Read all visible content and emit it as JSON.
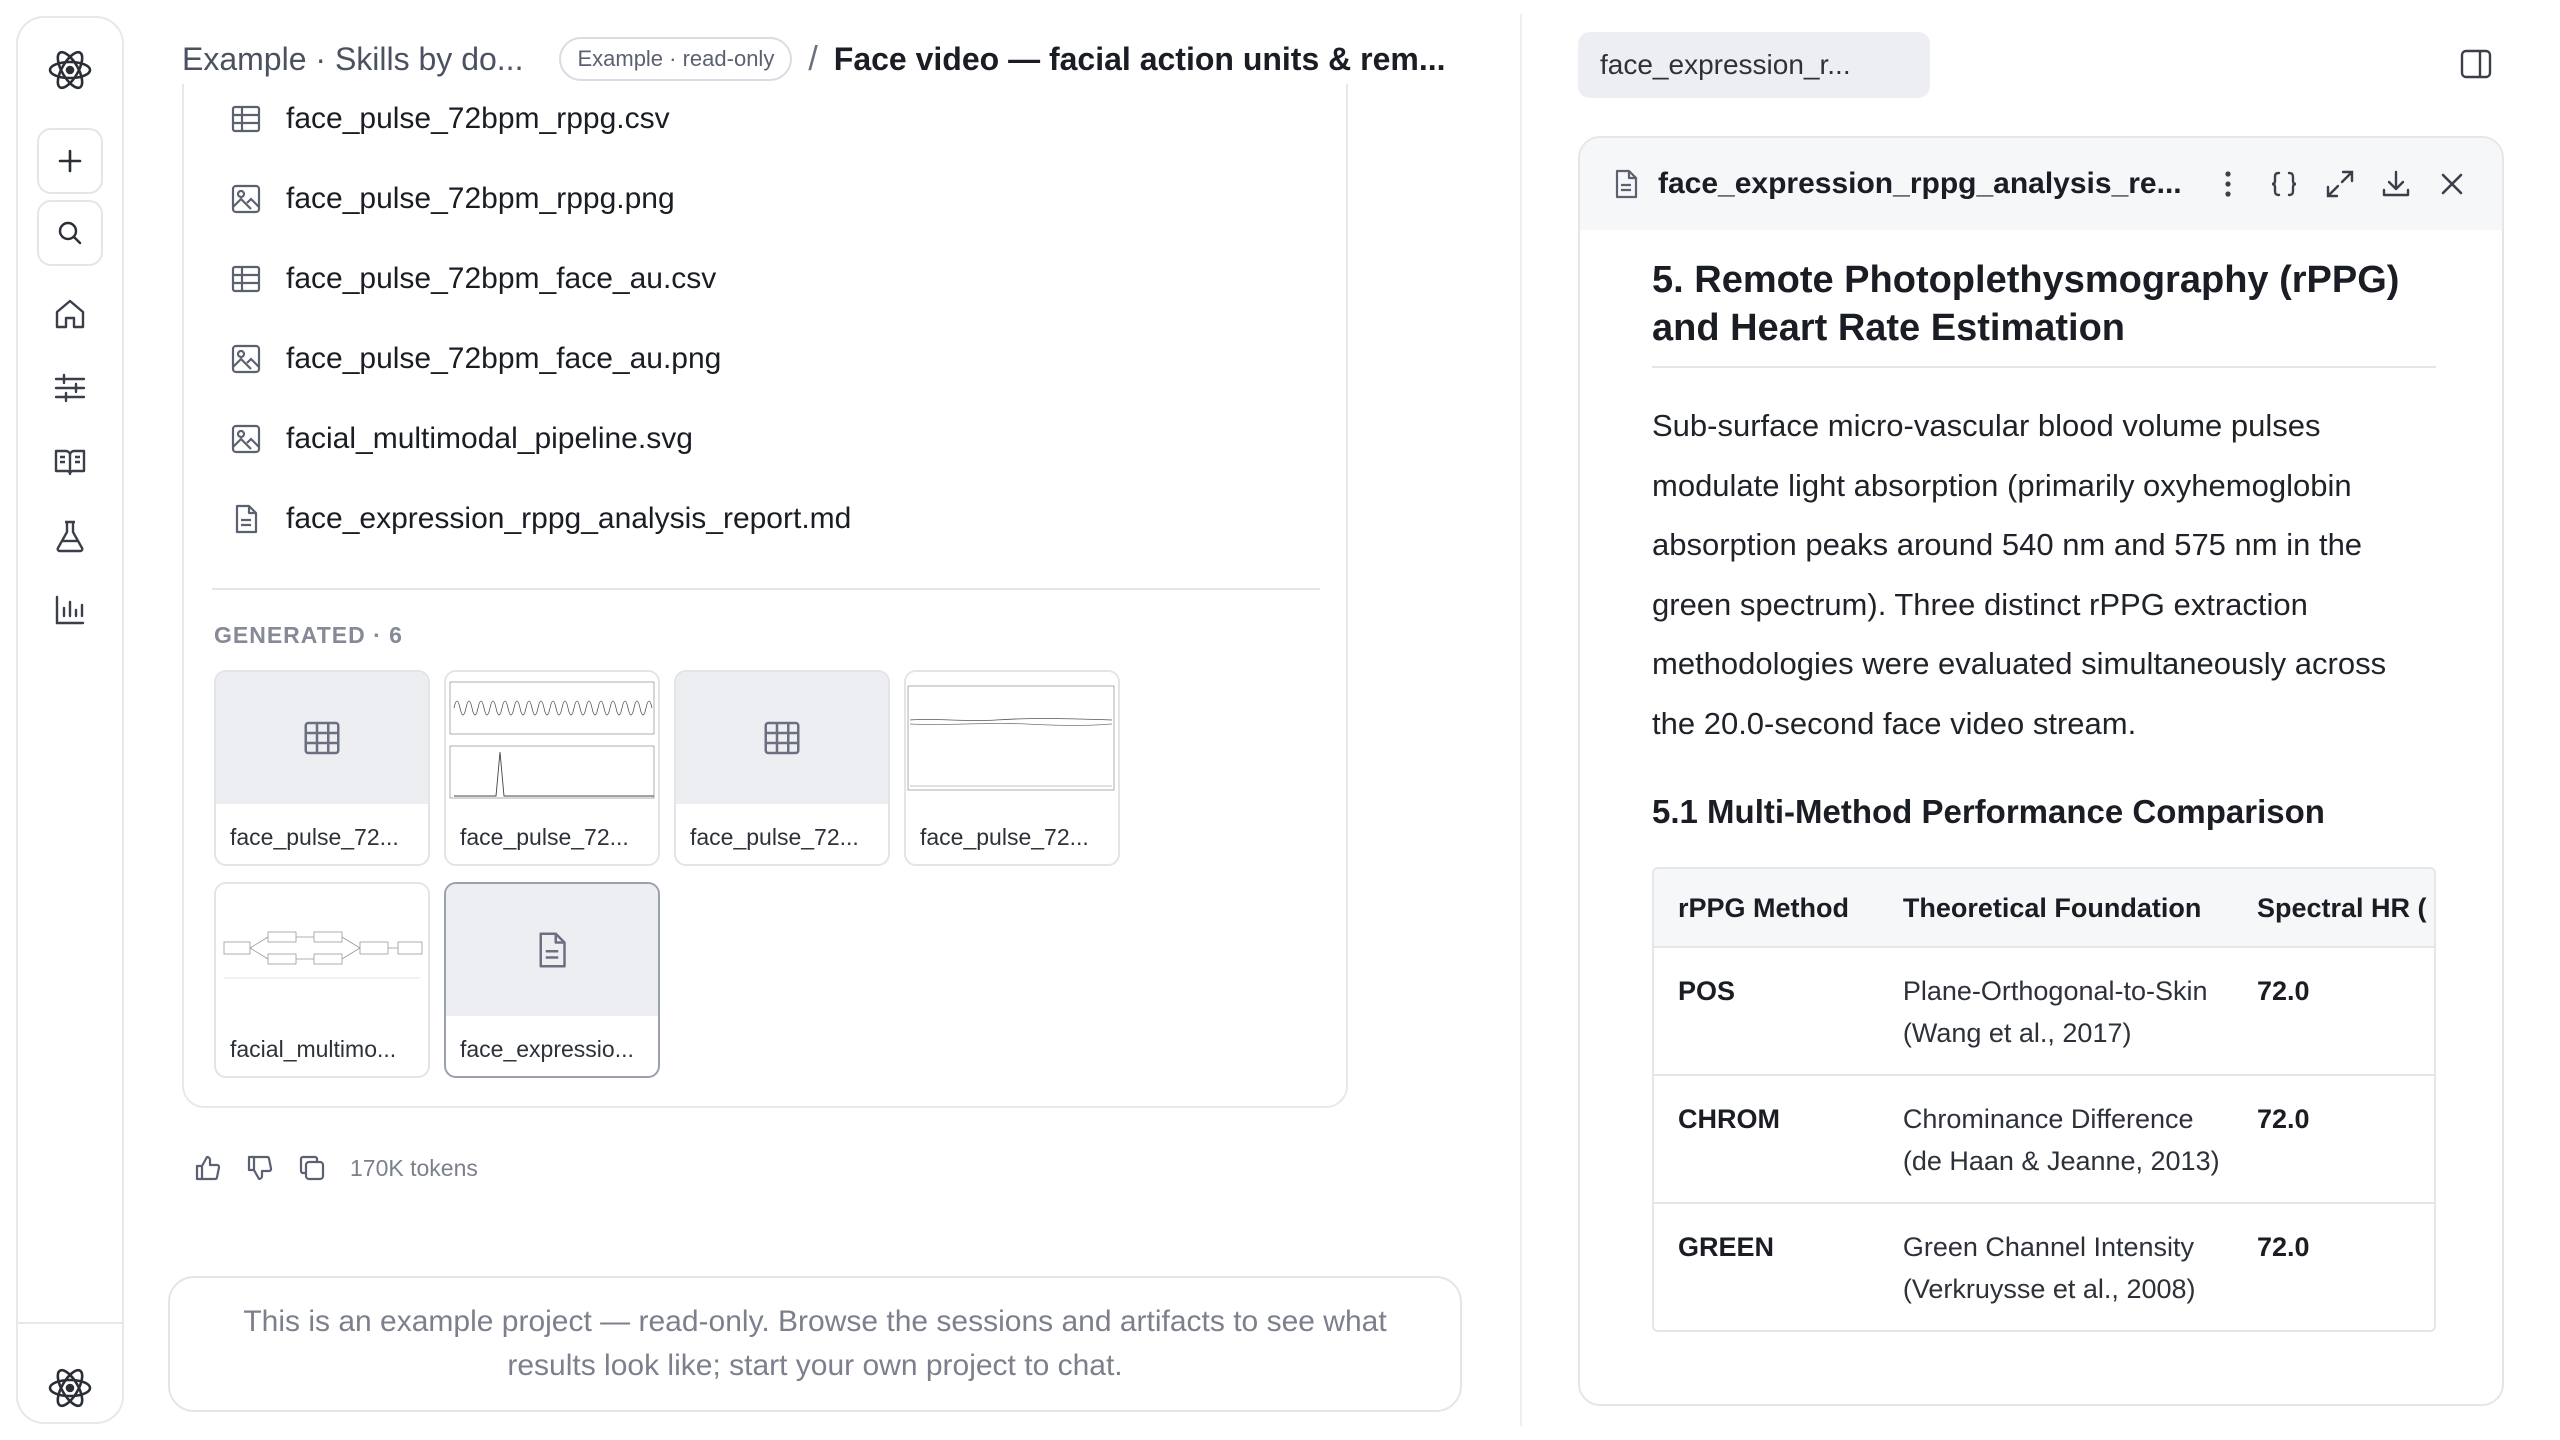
{
  "header": {
    "breadcrumb_project": "Example · Skills by do...",
    "readonly_badge": "Example · read-only",
    "separator": "/",
    "session_title": "Face video — facial action units & rem..."
  },
  "files": [
    {
      "name": "face_pulse_72bpm_rppg.csv",
      "icon": "table-icon"
    },
    {
      "name": "face_pulse_72bpm_rppg.png",
      "icon": "image-icon"
    },
    {
      "name": "face_pulse_72bpm_face_au.csv",
      "icon": "table-icon"
    },
    {
      "name": "face_pulse_72bpm_face_au.png",
      "icon": "image-icon"
    },
    {
      "name": "facial_multimodal_pipeline.svg",
      "icon": "image-icon"
    },
    {
      "name": "face_expression_rppg_analysis_report.md",
      "icon": "document-icon"
    }
  ],
  "generated": {
    "label": "GENERATED · 6",
    "tiles": [
      {
        "label": "face_pulse_72...",
        "thumb": "table-icon"
      },
      {
        "label": "face_pulse_72...",
        "thumb": "rppg-plot"
      },
      {
        "label": "face_pulse_72...",
        "thumb": "table-icon"
      },
      {
        "label": "face_pulse_72...",
        "thumb": "au-plot"
      },
      {
        "label": "facial_multimo...",
        "thumb": "pipeline-diagram"
      },
      {
        "label": "face_expressio...",
        "thumb": "document-icon"
      }
    ]
  },
  "actions": {
    "tokens": "170K tokens"
  },
  "notice": "This is an example project — read-only. Browse the sessions and artifacts to see what results look like; start your own project to chat.",
  "right_panel": {
    "tab_label": "face_expression_r...",
    "doc_title": "face_expression_rppg_analysis_re...",
    "section_heading": "5. Remote Photoplethysmography (rPPG) and Heart Rate Estimation",
    "paragraph": "Sub-surface micro-vascular blood volume pulses modulate light absorption (primarily oxyhemoglobin absorption peaks around 540 nm and 575 nm in the green spectrum). Three distinct rPPG extraction methodologies were evaluated simultaneously across the 20.0-second face video stream.",
    "subheading": "5.1 Multi-Method Performance Comparison",
    "table": {
      "headers": [
        "rPPG Method",
        "Theoretical Foundation",
        "Spectral HR ("
      ],
      "rows": [
        [
          "POS",
          "Plane-Orthogonal-to-Skin (Wang et al., 2017)",
          "72.0"
        ],
        [
          "CHROM",
          "Chrominance Difference (de Haan & Jeanne, 2013)",
          "72.0"
        ],
        [
          "GREEN",
          "Green Channel Intensity (Verkruysse et al., 2008)",
          "72.0"
        ]
      ]
    }
  },
  "colors": {
    "border": "#e6e8ec",
    "muted": "#7b808c",
    "text": "#1a1d23",
    "thumb_bg": "#eceef1"
  }
}
